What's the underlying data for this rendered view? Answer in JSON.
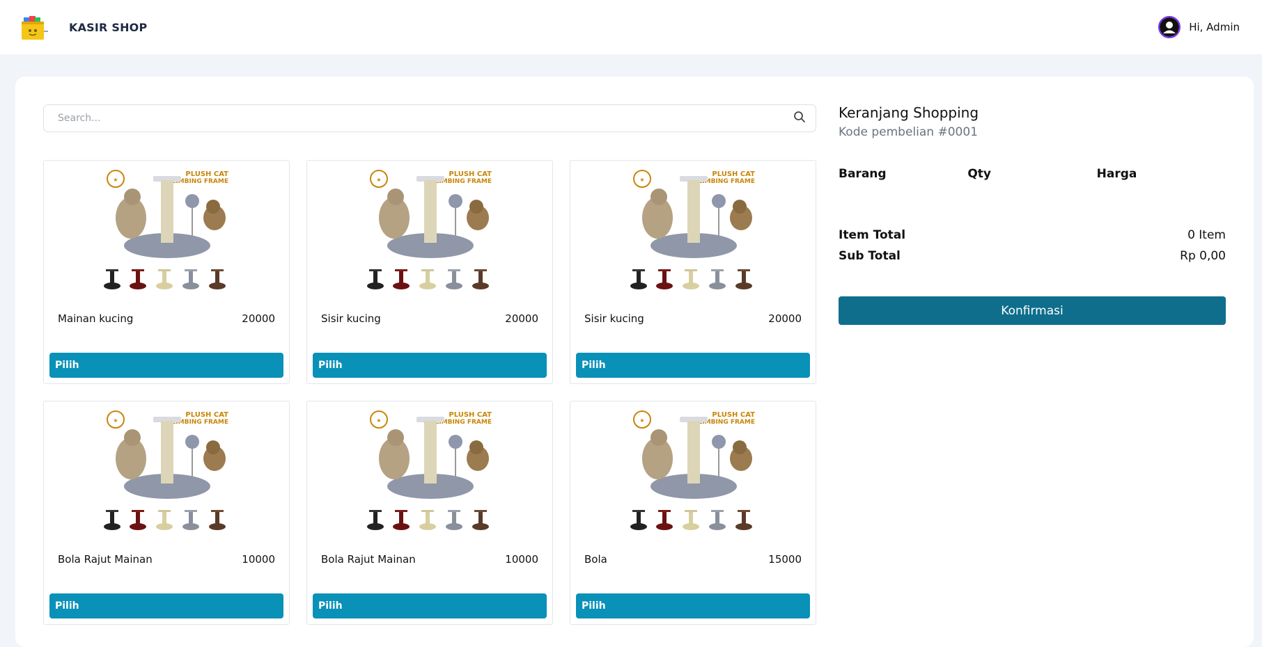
{
  "header": {
    "brand": "KASIR SHOP",
    "user_greeting": "Hi, Admin"
  },
  "search": {
    "placeholder": "Search..."
  },
  "products": [
    {
      "name": "Mainan kucing",
      "price": "20000",
      "button": "Pilih"
    },
    {
      "name": "Sisir kucing",
      "price": "20000",
      "button": "Pilih"
    },
    {
      "name": "Sisir kucing",
      "price": "20000",
      "button": "Pilih"
    },
    {
      "name": "Bola Rajut Mainan",
      "price": "10000",
      "button": "Pilih"
    },
    {
      "name": "Bola Rajut Mainan",
      "price": "10000",
      "button": "Pilih"
    },
    {
      "name": "Bola",
      "price": "15000",
      "button": "Pilih"
    }
  ],
  "product_image": {
    "title_line1": "PLUSH CAT",
    "title_line2": "CLIMBING FRAME"
  },
  "cart": {
    "title": "Keranjang Shopping",
    "code": "Kode pembelian #0001",
    "columns": [
      "Barang",
      "Qty",
      "Harga"
    ],
    "item_total_label": "Item Total",
    "item_total_value": "0 Item",
    "sub_total_label": "Sub Total",
    "sub_total_value": "Rp 0,00",
    "confirm_label": "Konfirmasi"
  },
  "colors": {
    "accent": "#0a91b8",
    "confirm": "#0f6e8c",
    "avatar_ring": "#7b2ff7"
  }
}
